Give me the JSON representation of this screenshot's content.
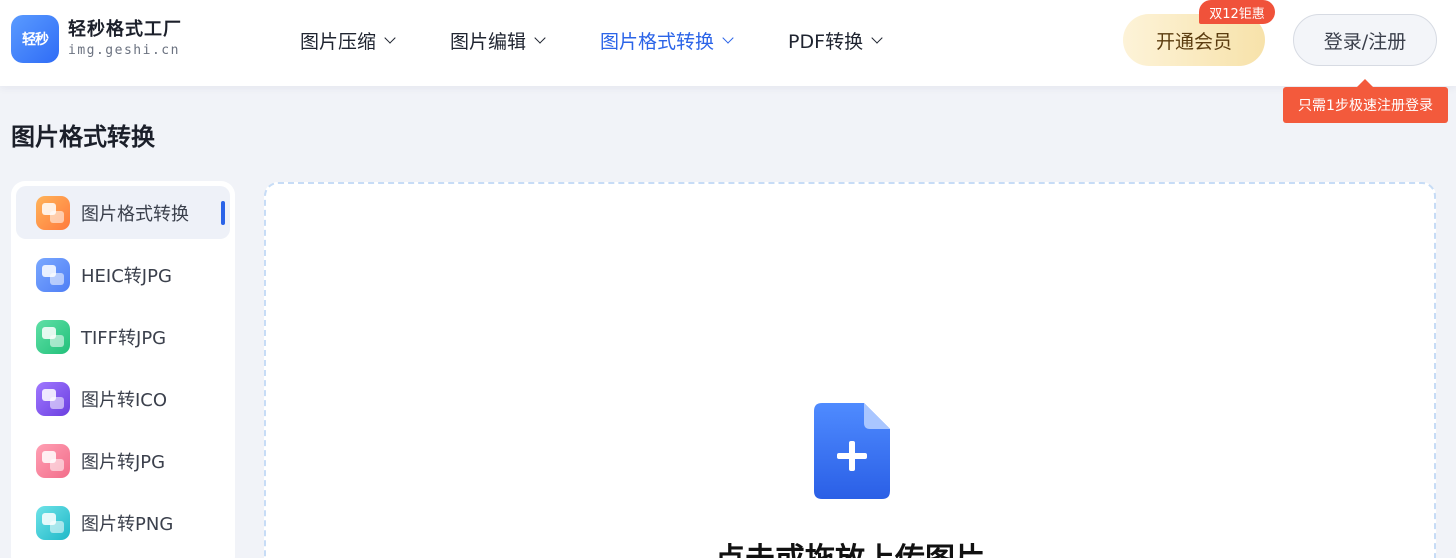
{
  "header": {
    "logo_badge": "轻秒",
    "logo_title": "轻秒格式工厂",
    "logo_sub": "img.geshi.cn",
    "nav": [
      {
        "label": "图片压缩",
        "active": false
      },
      {
        "label": "图片编辑",
        "active": false
      },
      {
        "label": "图片格式转换",
        "active": true
      },
      {
        "label": "PDF转换",
        "active": false
      }
    ],
    "vip_label": "开通会员",
    "promo_badge": "双12钜惠",
    "login_label": "登录/注册",
    "login_tooltip": "只需1步极速注册登录"
  },
  "page_title": "图片格式转换",
  "sidebar": {
    "items": [
      {
        "label": "图片格式转换",
        "active": true,
        "icon": "image-convert-icon",
        "color_a": "#ffb45a",
        "color_b": "#ff7a3d"
      },
      {
        "label": "HEIC转JPG",
        "active": false,
        "icon": "heic-icon",
        "color_a": "#7aa8ff",
        "color_b": "#4f7ef5"
      },
      {
        "label": "TIFF转JPG",
        "active": false,
        "icon": "tiff-icon",
        "color_a": "#5fe0a6",
        "color_b": "#22c07a"
      },
      {
        "label": "图片转ICO",
        "active": false,
        "icon": "ico-icon",
        "color_a": "#a078ff",
        "color_b": "#6b3fe0"
      },
      {
        "label": "图片转JPG",
        "active": false,
        "icon": "jpg-icon",
        "color_a": "#ffa0b4",
        "color_b": "#f26d8a"
      },
      {
        "label": "图片转PNG",
        "active": false,
        "icon": "png-icon",
        "color_a": "#6fe3e8",
        "color_b": "#1fb8c8"
      }
    ]
  },
  "upload": {
    "title": "点击或拖放上传图片"
  },
  "colors": {
    "accent": "#2b64e8",
    "promo": "#f0523a"
  }
}
